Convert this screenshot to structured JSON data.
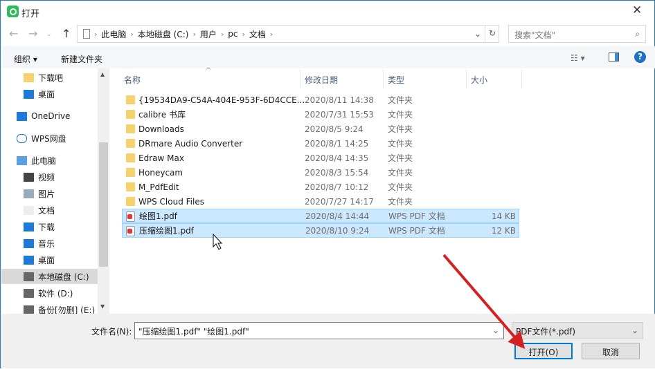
{
  "window": {
    "title": "打开"
  },
  "address": {
    "segments": [
      "此电脑",
      "本地磁盘 (C:)",
      "用户",
      "pc",
      "文档"
    ],
    "search_placeholder": "搜索\"文档\""
  },
  "toolbar": {
    "organize": "组织 ▾",
    "new_folder": "新建文件夹"
  },
  "sidebar": {
    "items": [
      {
        "label": "下载吧",
        "icon": "folder-icon"
      },
      {
        "label": "桌面",
        "icon": "desktop-icon"
      },
      {
        "label": "OneDrive",
        "icon": "cloud-icon"
      },
      {
        "label": "WPS网盘",
        "icon": "cloud-outline-icon"
      },
      {
        "label": "此电脑",
        "icon": "computer-icon"
      },
      {
        "label": "视频",
        "icon": "video-icon"
      },
      {
        "label": "图片",
        "icon": "pictures-icon"
      },
      {
        "label": "文档",
        "icon": "documents-icon"
      },
      {
        "label": "下载",
        "icon": "download-icon"
      },
      {
        "label": "音乐",
        "icon": "music-icon"
      },
      {
        "label": "桌面",
        "icon": "desktop-icon"
      },
      {
        "label": "本地磁盘 (C:)",
        "icon": "drive-icon"
      },
      {
        "label": "软件 (D:)",
        "icon": "drive-icon"
      },
      {
        "label": "备份[勿删] (E:)",
        "icon": "drive-icon"
      }
    ]
  },
  "columns": {
    "name": "名称",
    "date": "修改日期",
    "type": "类型",
    "size": "大小"
  },
  "files": [
    {
      "name": "{19534DA9-C54A-404E-953F-6D4CCE...",
      "date": "2020/8/11 14:38",
      "type": "文件夹",
      "size": ""
    },
    {
      "name": "calibre 书库",
      "date": "2020/7/31 15:53",
      "type": "文件夹",
      "size": ""
    },
    {
      "name": "Downloads",
      "date": "2020/8/5 9:24",
      "type": "文件夹",
      "size": ""
    },
    {
      "name": "DRmare Audio Converter",
      "date": "2020/8/1 14:25",
      "type": "文件夹",
      "size": ""
    },
    {
      "name": "Edraw Max",
      "date": "2020/8/4 14:35",
      "type": "文件夹",
      "size": ""
    },
    {
      "name": "Honeycam",
      "date": "2020/8/3 15:54",
      "type": "文件夹",
      "size": ""
    },
    {
      "name": "M_PdfEdit",
      "date": "2020/8/7 10:12",
      "type": "文件夹",
      "size": ""
    },
    {
      "name": "WPS Cloud Files",
      "date": "2020/7/27 14:17",
      "type": "文件夹",
      "size": ""
    },
    {
      "name": "绘图1.pdf",
      "date": "2020/8/4 14:44",
      "type": "WPS PDF 文档",
      "size": "14 KB"
    },
    {
      "name": "压缩绘图1.pdf",
      "date": "2020/8/10 9:24",
      "type": "WPS PDF 文档",
      "size": "12 KB"
    }
  ],
  "footer": {
    "filename_label": "文件名(N):",
    "filename_value": "\"压缩绘图1.pdf\" \"绘图1.pdf\"",
    "filter": "PDF文件(*.pdf)",
    "open": "打开(O)",
    "cancel": "取消"
  }
}
